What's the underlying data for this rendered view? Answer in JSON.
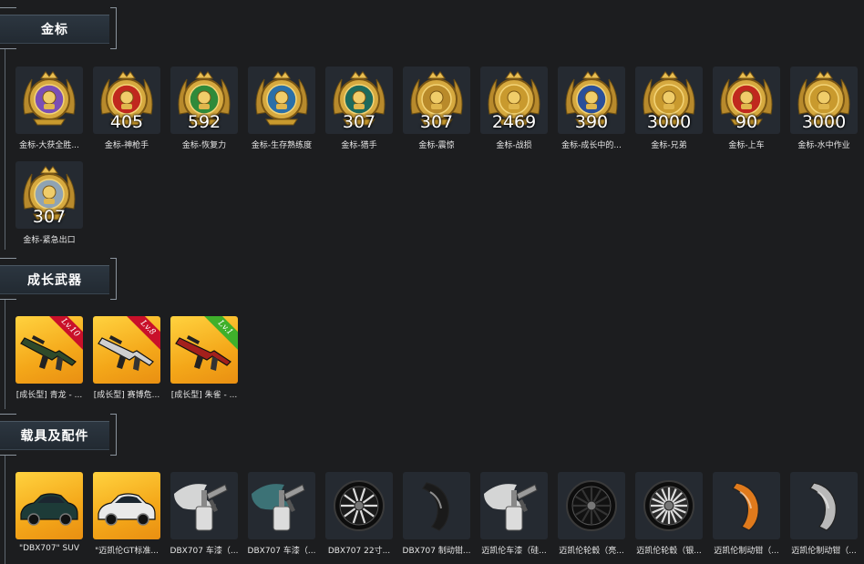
{
  "sections": {
    "gold": {
      "title": "金标"
    },
    "weapons": {
      "title": "成长武器"
    },
    "vehicles": {
      "title": "载具及配件"
    }
  },
  "gold_items": [
    {
      "label": "金标-大获全胜...",
      "count": "",
      "icon": "eagle-crest-icon",
      "accent": "#7a4fb5"
    },
    {
      "label": "金标-神枪手",
      "count": "405",
      "icon": "target-crest-icon",
      "accent": "#c0281e"
    },
    {
      "label": "金标-恢复力",
      "count": "592",
      "icon": "fist-crest-icon",
      "accent": "#2f8a3a"
    },
    {
      "label": "金标-生存熟练度",
      "count": "",
      "icon": "soldier-crest-icon",
      "accent": "#2a6fa8"
    },
    {
      "label": "金标-猎手",
      "count": "307",
      "icon": "helmet-crest-icon",
      "accent": "#1d6a5c"
    },
    {
      "label": "金标-震惊",
      "count": "307",
      "icon": "ammo-crest-icon",
      "accent": "#b98a2a"
    },
    {
      "label": "金标-战损",
      "count": "2469",
      "icon": "soldier-figure-icon",
      "accent": "#c99a2e"
    },
    {
      "label": "金标-成长中的...",
      "count": "390",
      "icon": "helmet-star-icon",
      "accent": "#2a4f9a"
    },
    {
      "label": "金标-兄弟",
      "count": "3000",
      "icon": "squad-crest-icon",
      "accent": "#c99a2e"
    },
    {
      "label": "金标-上车",
      "count": "90",
      "icon": "car-crest-icon",
      "accent": "#c0281e"
    },
    {
      "label": "金标-水中作业",
      "count": "3000",
      "icon": "seal-crest-icon",
      "accent": "#c99a2e"
    },
    {
      "label": "金标-紧急出口",
      "count": "307",
      "icon": "parachute-crest-icon",
      "accent": "#8fa3b3"
    }
  ],
  "weapon_items": [
    {
      "label": "[成长型] 青龙 - ...",
      "level": "Lv.10",
      "level_color": "#c9102a",
      "icon": "rifle-dragon-icon"
    },
    {
      "label": "[成长型] 赛博危...",
      "level": "Lv.8",
      "level_color": "#c9102a",
      "icon": "rifle-cyber-icon"
    },
    {
      "label": "[成长型] 朱雀 - ...",
      "level": "Lv.1",
      "level_color": "#3fb02b",
      "icon": "rifle-phoenix-icon"
    }
  ],
  "vehicle_items": [
    {
      "label": "\"DBX707\" SUV",
      "icon": "suv-car-icon",
      "tile": "gold"
    },
    {
      "label": "\"迈凯伦GT标准...",
      "icon": "sports-car-icon",
      "tile": "gold"
    },
    {
      "label": "DBX707 车漆（...",
      "icon": "paint-spray-white-icon",
      "tile": "dark"
    },
    {
      "label": "DBX707 车漆（...",
      "icon": "paint-spray-teal-icon",
      "tile": "dark"
    },
    {
      "label": "DBX707 22寸...",
      "icon": "wheel-rim-icon",
      "tile": "dark"
    },
    {
      "label": "DBX707 制动钳...",
      "icon": "brake-caliper-black-icon",
      "tile": "dark"
    },
    {
      "label": "迈凯伦车漆（硅...",
      "icon": "paint-spray-white-icon",
      "tile": "dark"
    },
    {
      "label": "迈凯伦轮毂（亮...",
      "icon": "wheel-black-icon",
      "tile": "dark"
    },
    {
      "label": "迈凯伦轮毂（银...",
      "icon": "wheel-silver-icon",
      "tile": "dark"
    },
    {
      "label": "迈凯伦制动钳（...",
      "icon": "brake-caliper-orange-icon",
      "tile": "dark"
    },
    {
      "label": "迈凯伦制动钳（...",
      "icon": "brake-caliper-silver-icon",
      "tile": "dark"
    }
  ]
}
